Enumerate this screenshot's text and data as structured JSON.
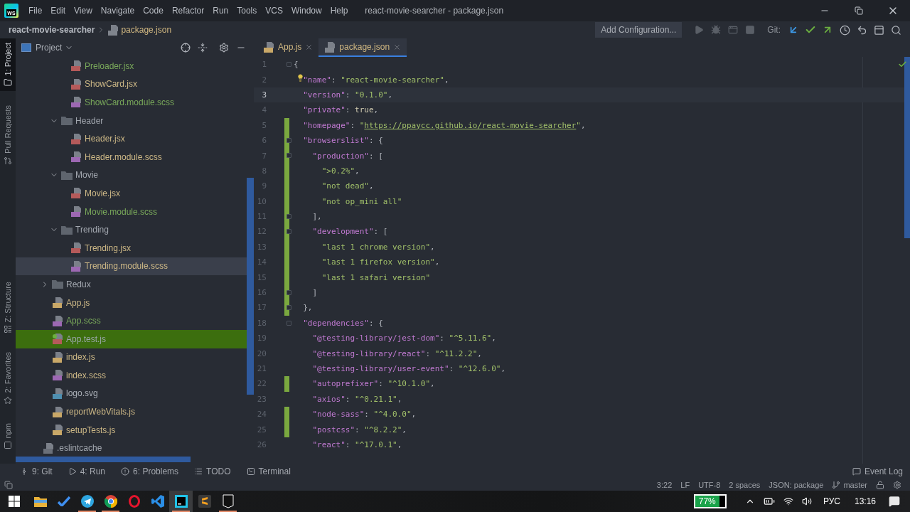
{
  "app": {
    "logo_text": "WS",
    "menu": [
      "File",
      "Edit",
      "View",
      "Navigate",
      "Code",
      "Refactor",
      "Run",
      "Tools",
      "VCS",
      "Window",
      "Help"
    ],
    "title": "react-movie-searcher - package.json"
  },
  "breadcrumb": [
    "react-movie-searcher",
    "package.json"
  ],
  "toolbar": {
    "run_config": "Add Configuration...",
    "run_actions": [
      {
        "kind": "run",
        "disabled": true
      },
      {
        "kind": "debug",
        "disabled": true
      },
      {
        "kind": "coverage",
        "disabled": true
      },
      {
        "kind": "stop",
        "disabled": true
      }
    ],
    "vcs_label": "Git:"
  },
  "tool_stripe": {
    "top": [
      {
        "label": "1: Project",
        "kind": "project",
        "selected": true
      },
      {
        "label": "Pull Requests",
        "kind": "pull-requests",
        "selected": false
      }
    ],
    "bottom": [
      {
        "label": "Z: Structure",
        "kind": "structure",
        "selected": false
      },
      {
        "label": "2: Favorites",
        "kind": "favorites",
        "selected": false
      },
      {
        "label": "npm",
        "kind": "npm",
        "selected": false
      }
    ]
  },
  "project_panel": {
    "title": "Project",
    "tree": [
      {
        "children": [
          {
            "children": [
              {
                "children": [
                  {
                    "name": "Preloader.jsx",
                    "kind": "jsx",
                    "color": "#79a85a",
                    "selected": false,
                    "test": false
                  },
                  {
                    "name": "ShowCard.jsx",
                    "kind": "jsx",
                    "color": "#cdb886",
                    "selected": false,
                    "test": false
                  },
                  {
                    "name": "ShowCard.module.scss",
                    "kind": "scss",
                    "color": "#79a85a",
                    "selected": false,
                    "test": false
                  }
                ]
              },
              {
                "name": "Header",
                "kind": "folder",
                "color": "#a3a8b0",
                "expanded": true,
                "selected": false,
                "children": [
                  {
                    "name": "Header.jsx",
                    "kind": "jsx",
                    "color": "#cdb886",
                    "selected": false,
                    "test": false
                  },
                  {
                    "name": "Header.module.scss",
                    "kind": "scss",
                    "color": "#cdb886",
                    "selected": false,
                    "test": false
                  }
                ]
              },
              {
                "name": "Movie",
                "kind": "folder",
                "color": "#a3a8b0",
                "expanded": true,
                "selected": false,
                "children": [
                  {
                    "name": "Movie.jsx",
                    "kind": "jsx",
                    "color": "#cdb886",
                    "selected": false,
                    "test": false
                  },
                  {
                    "name": "Movie.module.scss",
                    "kind": "scss",
                    "color": "#79a85a",
                    "selected": false,
                    "test": false
                  }
                ]
              },
              {
                "name": "Trending",
                "kind": "folder",
                "color": "#a3a8b0",
                "expanded": true,
                "selected": false,
                "children": [
                  {
                    "name": "Trending.jsx",
                    "kind": "jsx",
                    "color": "#cdb886",
                    "selected": false,
                    "test": false
                  },
                  {
                    "name": "Trending.module.scss",
                    "kind": "scss",
                    "color": "#cdb886",
                    "selected": true,
                    "test": false
                  }
                ]
              }
            ]
          },
          {
            "name": "Redux",
            "kind": "folder",
            "color": "#a3a8b0",
            "expanded": false,
            "selected": false
          },
          {
            "name": "App.js",
            "kind": "js",
            "color": "#cdb886",
            "selected": false,
            "test": false
          },
          {
            "name": "App.scss",
            "kind": "scss",
            "color": "#79a85a",
            "selected": false,
            "test": false
          },
          {
            "name": "App.test.js",
            "kind": "test",
            "color": "#9aa7a8",
            "selected": false,
            "test": true
          },
          {
            "name": "index.js",
            "kind": "js",
            "color": "#cdb886",
            "selected": false,
            "test": false
          },
          {
            "name": "index.scss",
            "kind": "scss",
            "color": "#cdb886",
            "selected": false,
            "test": false
          },
          {
            "name": "logo.svg",
            "kind": "svg",
            "color": "#a9aeb6",
            "selected": false,
            "test": false
          },
          {
            "name": "reportWebVitals.js",
            "kind": "js",
            "color": "#cdb886",
            "selected": false,
            "test": false
          },
          {
            "name": "setupTests.js",
            "kind": "js",
            "color": "#cdb886",
            "selected": false,
            "test": false
          }
        ]
      },
      {
        "name": ".eslintcache",
        "kind": "file",
        "color": "#a3a8b0",
        "selected": false,
        "test": false
      }
    ]
  },
  "editor": {
    "tabs": [
      {
        "label": "App.js",
        "kind": "js",
        "selected": false
      },
      {
        "label": "package.json",
        "kind": "json",
        "selected": true
      }
    ],
    "lines": [
      {
        "number": "1",
        "tokens": [
          {
            "kind": "punct",
            "text": "{"
          }
        ],
        "current": false,
        "changed": false,
        "fold": true,
        "bulb": false,
        "children": [
          {
            "number": "2",
            "tokens": [
              {
                "kind": "key",
                "text": "\"name\""
              },
              {
                "kind": "punct",
                "text": ": "
              },
              {
                "kind": "str",
                "text": "\"react-movie-searcher\""
              },
              {
                "kind": "punct",
                "text": ","
              }
            ],
            "current": false,
            "changed": false,
            "fold": false,
            "bulb": true
          },
          {
            "number": "3",
            "tokens": [
              {
                "kind": "key",
                "text": "\"version\""
              },
              {
                "kind": "punct",
                "text": ": "
              },
              {
                "kind": "str",
                "text": "\"0.1.0\""
              },
              {
                "kind": "punct",
                "text": ","
              }
            ],
            "current": true,
            "changed": false,
            "fold": false,
            "bulb": false
          },
          {
            "number": "4",
            "tokens": [
              {
                "kind": "key",
                "text": "\"private\""
              },
              {
                "kind": "punct",
                "text": ": "
              },
              {
                "kind": "kw",
                "text": "true"
              },
              {
                "kind": "punct",
                "text": ","
              }
            ],
            "current": false,
            "changed": false,
            "fold": false,
            "bulb": false
          },
          {
            "number": "5",
            "tokens": [
              {
                "kind": "key",
                "text": "\"homepage\""
              },
              {
                "kind": "punct",
                "text": ": "
              },
              {
                "kind": "str",
                "text": "\""
              },
              {
                "kind": "link",
                "text": "https://ppaycc.github.io/react-movie-searcher"
              },
              {
                "kind": "str",
                "text": "\""
              },
              {
                "kind": "punct",
                "text": ","
              }
            ],
            "current": false,
            "changed": true,
            "fold": false,
            "bulb": false
          },
          {
            "number": "6",
            "tokens": [
              {
                "kind": "key",
                "text": "\"browserslist\""
              },
              {
                "kind": "punct",
                "text": ": {"
              }
            ],
            "current": false,
            "changed": true,
            "fold": true,
            "bulb": false,
            "children": [
              {
                "number": "7",
                "tokens": [
                  {
                    "kind": "key",
                    "text": "\"production\""
                  },
                  {
                    "kind": "punct",
                    "text": ": ["
                  }
                ],
                "current": false,
                "changed": true,
                "fold": true,
                "bulb": false,
                "children": [
                  {
                    "number": "8",
                    "tokens": [
                      {
                        "kind": "str",
                        "text": "\">0.2%\""
                      },
                      {
                        "kind": "punct",
                        "text": ","
                      }
                    ],
                    "current": false,
                    "changed": true,
                    "fold": false,
                    "bulb": false
                  },
                  {
                    "number": "9",
                    "tokens": [
                      {
                        "kind": "str",
                        "text": "\"not dead\""
                      },
                      {
                        "kind": "punct",
                        "text": ","
                      }
                    ],
                    "current": false,
                    "changed": true,
                    "fold": false,
                    "bulb": false
                  },
                  {
                    "number": "10",
                    "tokens": [
                      {
                        "kind": "str",
                        "text": "\"not op_mini all\""
                      }
                    ],
                    "current": false,
                    "changed": true,
                    "fold": false,
                    "bulb": false
                  }
                ]
              },
              {
                "number": "11",
                "tokens": [
                  {
                    "kind": "punct",
                    "text": "],"
                  }
                ],
                "current": false,
                "changed": true,
                "fold": true,
                "bulb": false
              },
              {
                "number": "12",
                "tokens": [
                  {
                    "kind": "key",
                    "text": "\"development\""
                  },
                  {
                    "kind": "punct",
                    "text": ": ["
                  }
                ],
                "current": false,
                "changed": true,
                "fold": true,
                "bulb": false,
                "children": [
                  {
                    "number": "13",
                    "tokens": [
                      {
                        "kind": "str",
                        "text": "\"last 1 chrome version\""
                      },
                      {
                        "kind": "punct",
                        "text": ","
                      }
                    ],
                    "current": false,
                    "changed": true,
                    "fold": false,
                    "bulb": false
                  },
                  {
                    "number": "14",
                    "tokens": [
                      {
                        "kind": "str",
                        "text": "\"last 1 firefox version\""
                      },
                      {
                        "kind": "punct",
                        "text": ","
                      }
                    ],
                    "current": false,
                    "changed": true,
                    "fold": false,
                    "bulb": false
                  },
                  {
                    "number": "15",
                    "tokens": [
                      {
                        "kind": "str",
                        "text": "\"last 1 safari version\""
                      }
                    ],
                    "current": false,
                    "changed": true,
                    "fold": false,
                    "bulb": false
                  }
                ]
              },
              {
                "number": "16",
                "tokens": [
                  {
                    "kind": "punct",
                    "text": "]"
                  }
                ],
                "current": false,
                "changed": true,
                "fold": true,
                "bulb": false
              }
            ]
          },
          {
            "number": "17",
            "tokens": [
              {
                "kind": "punct",
                "text": "},"
              }
            ],
            "current": false,
            "changed": true,
            "fold": true,
            "bulb": false
          },
          {
            "number": "18",
            "tokens": [
              {
                "kind": "key",
                "text": "\"dependencies\""
              },
              {
                "kind": "punct",
                "text": ": {"
              }
            ],
            "current": false,
            "changed": false,
            "fold": true,
            "bulb": false,
            "children": [
              {
                "number": "19",
                "tokens": [
                  {
                    "kind": "key",
                    "text": "\"@testing-library/jest-dom\""
                  },
                  {
                    "kind": "punct",
                    "text": ": "
                  },
                  {
                    "kind": "str",
                    "text": "\"^5.11.6\""
                  },
                  {
                    "kind": "punct",
                    "text": ","
                  }
                ],
                "current": false,
                "changed": false,
                "fold": false,
                "bulb": false
              },
              {
                "number": "20",
                "tokens": [
                  {
                    "kind": "key",
                    "text": "\"@testing-library/react\""
                  },
                  {
                    "kind": "punct",
                    "text": ": "
                  },
                  {
                    "kind": "str",
                    "text": "\"^11.2.2\""
                  },
                  {
                    "kind": "punct",
                    "text": ","
                  }
                ],
                "current": false,
                "changed": false,
                "fold": false,
                "bulb": false
              },
              {
                "number": "21",
                "tokens": [
                  {
                    "kind": "key",
                    "text": "\"@testing-library/user-event\""
                  },
                  {
                    "kind": "punct",
                    "text": ": "
                  },
                  {
                    "kind": "str",
                    "text": "\"^12.6.0\""
                  },
                  {
                    "kind": "punct",
                    "text": ","
                  }
                ],
                "current": false,
                "changed": false,
                "fold": false,
                "bulb": false
              },
              {
                "number": "22",
                "tokens": [
                  {
                    "kind": "key",
                    "text": "\"autoprefixer\""
                  },
                  {
                    "kind": "punct",
                    "text": ": "
                  },
                  {
                    "kind": "str",
                    "text": "\"^10.1.0\""
                  },
                  {
                    "kind": "punct",
                    "text": ","
                  }
                ],
                "current": false,
                "changed": true,
                "fold": false,
                "bulb": false
              },
              {
                "number": "23",
                "tokens": [
                  {
                    "kind": "key",
                    "text": "\"axios\""
                  },
                  {
                    "kind": "punct",
                    "text": ": "
                  },
                  {
                    "kind": "str",
                    "text": "\"^0.21.1\""
                  },
                  {
                    "kind": "punct",
                    "text": ","
                  }
                ],
                "current": false,
                "changed": false,
                "fold": false,
                "bulb": false
              },
              {
                "number": "24",
                "tokens": [
                  {
                    "kind": "key",
                    "text": "\"node-sass\""
                  },
                  {
                    "kind": "punct",
                    "text": ": "
                  },
                  {
                    "kind": "str",
                    "text": "\"^4.0.0\""
                  },
                  {
                    "kind": "punct",
                    "text": ","
                  }
                ],
                "current": false,
                "changed": true,
                "fold": false,
                "bulb": false
              },
              {
                "number": "25",
                "tokens": [
                  {
                    "kind": "key",
                    "text": "\"postcss\""
                  },
                  {
                    "kind": "punct",
                    "text": ": "
                  },
                  {
                    "kind": "str",
                    "text": "\"^8.2.2\""
                  },
                  {
                    "kind": "punct",
                    "text": ","
                  }
                ],
                "current": false,
                "changed": true,
                "fold": false,
                "bulb": false
              },
              {
                "number": "26",
                "tokens": [
                  {
                    "kind": "key",
                    "text": "\"react\""
                  },
                  {
                    "kind": "punct",
                    "text": ": "
                  },
                  {
                    "kind": "str",
                    "text": "\"^17.0.1\""
                  },
                  {
                    "kind": "punct",
                    "text": ","
                  }
                ],
                "current": false,
                "changed": false,
                "fold": false,
                "bulb": false
              }
            ]
          }
        ]
      }
    ]
  },
  "tool_windows": [
    {
      "label": "9: Git",
      "kind": "git"
    },
    {
      "label": "4: Run",
      "kind": "run"
    },
    {
      "label": "6: Problems",
      "kind": "problems"
    },
    {
      "label": "TODO",
      "kind": "todo"
    },
    {
      "label": "Terminal",
      "kind": "terminal"
    }
  ],
  "event_log": "Event Log",
  "status_bar": {
    "items": [
      "3:22",
      "LF",
      "UTF-8",
      "2 spaces",
      "JSON: package"
    ],
    "branch": "master"
  },
  "taskbar": {
    "apps": [
      {
        "kind": "explorer",
        "running": false,
        "selected": false
      },
      {
        "kind": "todo",
        "running": false,
        "selected": false
      },
      {
        "kind": "telegram",
        "running": true,
        "selected": false
      },
      {
        "kind": "chrome",
        "running": true,
        "selected": false
      },
      {
        "kind": "opera",
        "running": false,
        "selected": false
      },
      {
        "kind": "vscode",
        "running": false,
        "selected": false
      },
      {
        "kind": "webstorm",
        "running": true,
        "selected": true
      },
      {
        "kind": "sublime",
        "running": false,
        "selected": false
      },
      {
        "kind": "epic",
        "running": true,
        "selected": false
      }
    ],
    "battery": "77%",
    "language": "РУС",
    "clock": "13:16"
  }
}
